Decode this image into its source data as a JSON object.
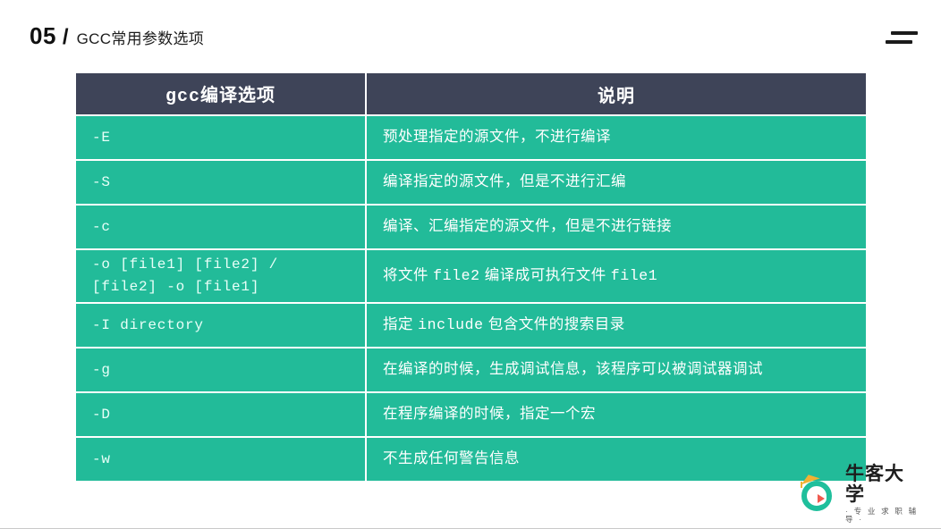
{
  "header": {
    "number": "05",
    "separator": "/",
    "title": "GCC常用参数选项",
    "menu_icon": "hamburger-menu-icon"
  },
  "table": {
    "columns": [
      {
        "label": "gcc编译选项"
      },
      {
        "label": "说明"
      }
    ],
    "rows": [
      {
        "option": "-E",
        "description": "预处理指定的源文件，不进行编译"
      },
      {
        "option": "-S",
        "description": "编译指定的源文件，但是不进行汇编"
      },
      {
        "option": "-c",
        "description": "编译、汇编指定的源文件，但是不进行链接"
      },
      {
        "option": "-o [file1] [file2] /\n[file2] -o [file1]",
        "desc_pre": "将文件 ",
        "desc_mono1": "file2",
        "desc_mid": " 编译成可执行文件 ",
        "desc_mono2": "file1",
        "description": "将文件 file2 编译成可执行文件 file1"
      },
      {
        "option": "-I directory",
        "desc_pre": "指定 ",
        "desc_mono1": "include",
        "desc_mid": " 包含文件的搜索目录",
        "description": "指定 include 包含文件的搜索目录"
      },
      {
        "option": "-g",
        "description": "在编译的时候，生成调试信息，该程序可以被调试器调试"
      },
      {
        "option": "-D",
        "description": "在程序编译的时候，指定一个宏"
      },
      {
        "option": "-w",
        "description": "不生成任何警告信息"
      }
    ]
  },
  "logo": {
    "name": "牛客大学",
    "tagline": "· 专 业 求 职 辅 导 ·"
  },
  "colors": {
    "header_bg": "#3e4458",
    "cell_bg": "#22bb99",
    "accent_green": "#1fbf9c",
    "play_red": "#f05a4f",
    "cap_yellow": "#f2b233"
  }
}
